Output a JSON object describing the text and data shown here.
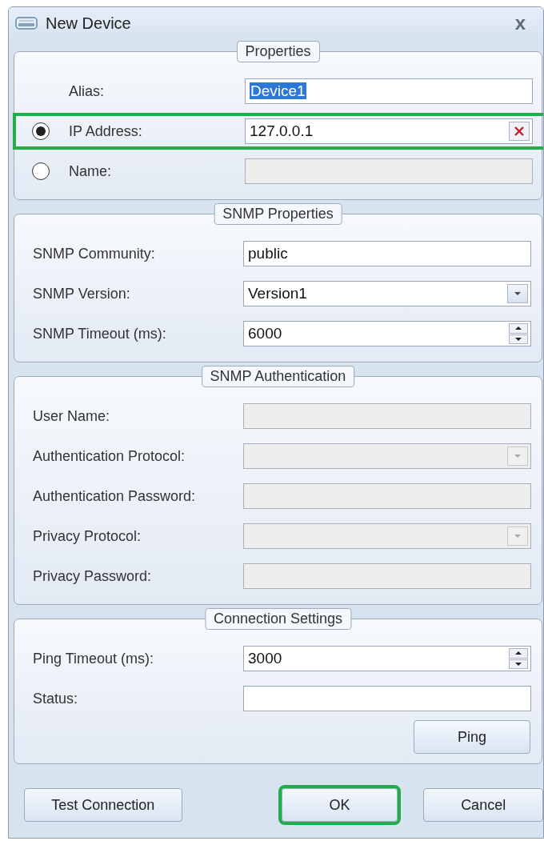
{
  "window": {
    "title": "New Device",
    "close": "x"
  },
  "groups": [
    {
      "title": "Properties",
      "rows": [
        {
          "kind": "text",
          "label": "Alias:",
          "value": "Device1",
          "value_selected": true,
          "disabled": false
        },
        {
          "kind": "radio",
          "label": "IP Address:",
          "selected": true,
          "value": "127.0.0.1",
          "clear_button": true,
          "highlighted": true,
          "disabled": false
        },
        {
          "kind": "radio",
          "label": "Name:",
          "selected": false,
          "disabled": true
        }
      ]
    },
    {
      "title": "SNMP Properties",
      "rows": [
        {
          "kind": "text",
          "label": "SNMP Community:",
          "value": "public",
          "disabled": false
        },
        {
          "kind": "combo",
          "label": "SNMP Version:",
          "value": "Version1",
          "disabled": false
        },
        {
          "kind": "spin",
          "label": "SNMP Timeout (ms):",
          "value": "6000",
          "disabled": false
        }
      ]
    },
    {
      "title": "SNMP Authentication",
      "rows": [
        {
          "kind": "text",
          "label": "User Name:",
          "disabled": true
        },
        {
          "kind": "combo",
          "label": "Authentication Protocol:",
          "disabled": true
        },
        {
          "kind": "text",
          "label": "Authentication Password:",
          "disabled": true
        },
        {
          "kind": "combo",
          "label": "Privacy Protocol:",
          "disabled": true
        },
        {
          "kind": "text",
          "label": "Privacy Password:",
          "disabled": true
        }
      ]
    },
    {
      "title": "Connection Settings",
      "rows": [
        {
          "kind": "spin",
          "label": "Ping Timeout (ms):",
          "value": "3000",
          "disabled": false
        },
        {
          "kind": "text",
          "label": "Status:",
          "disabled": false
        },
        {
          "kind": "button",
          "label": "Ping"
        }
      ]
    }
  ],
  "buttons": [
    {
      "label": "Test Connection",
      "highlighted": false
    },
    {
      "label": "OK",
      "highlighted": true
    },
    {
      "label": "Cancel",
      "highlighted": false
    }
  ]
}
